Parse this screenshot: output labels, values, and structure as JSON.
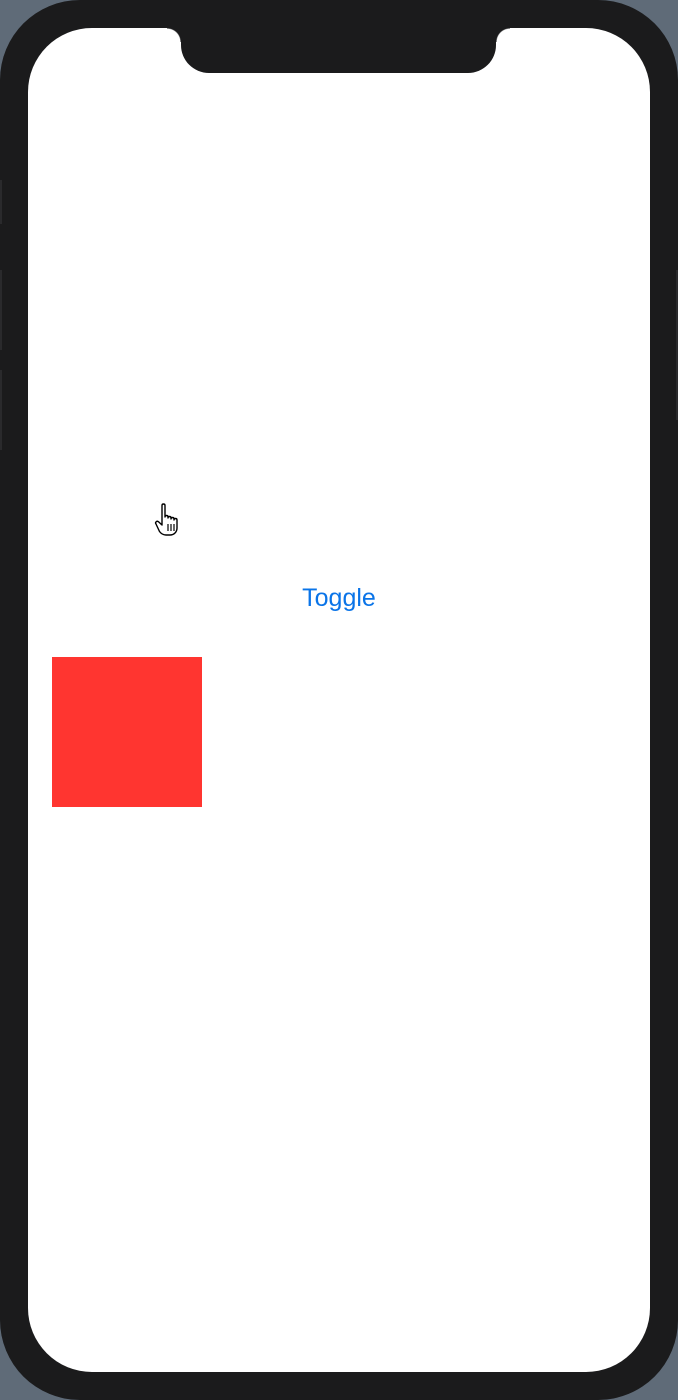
{
  "app": {
    "toggle_label": "Toggle"
  },
  "colors": {
    "device_frame": "#1b1b1c",
    "background": "#5f6b78",
    "screen": "#ffffff",
    "accent": "#0a74e8",
    "square_fill": "#ff3530"
  },
  "icons": {
    "cursor": "hand-pointer-icon"
  }
}
